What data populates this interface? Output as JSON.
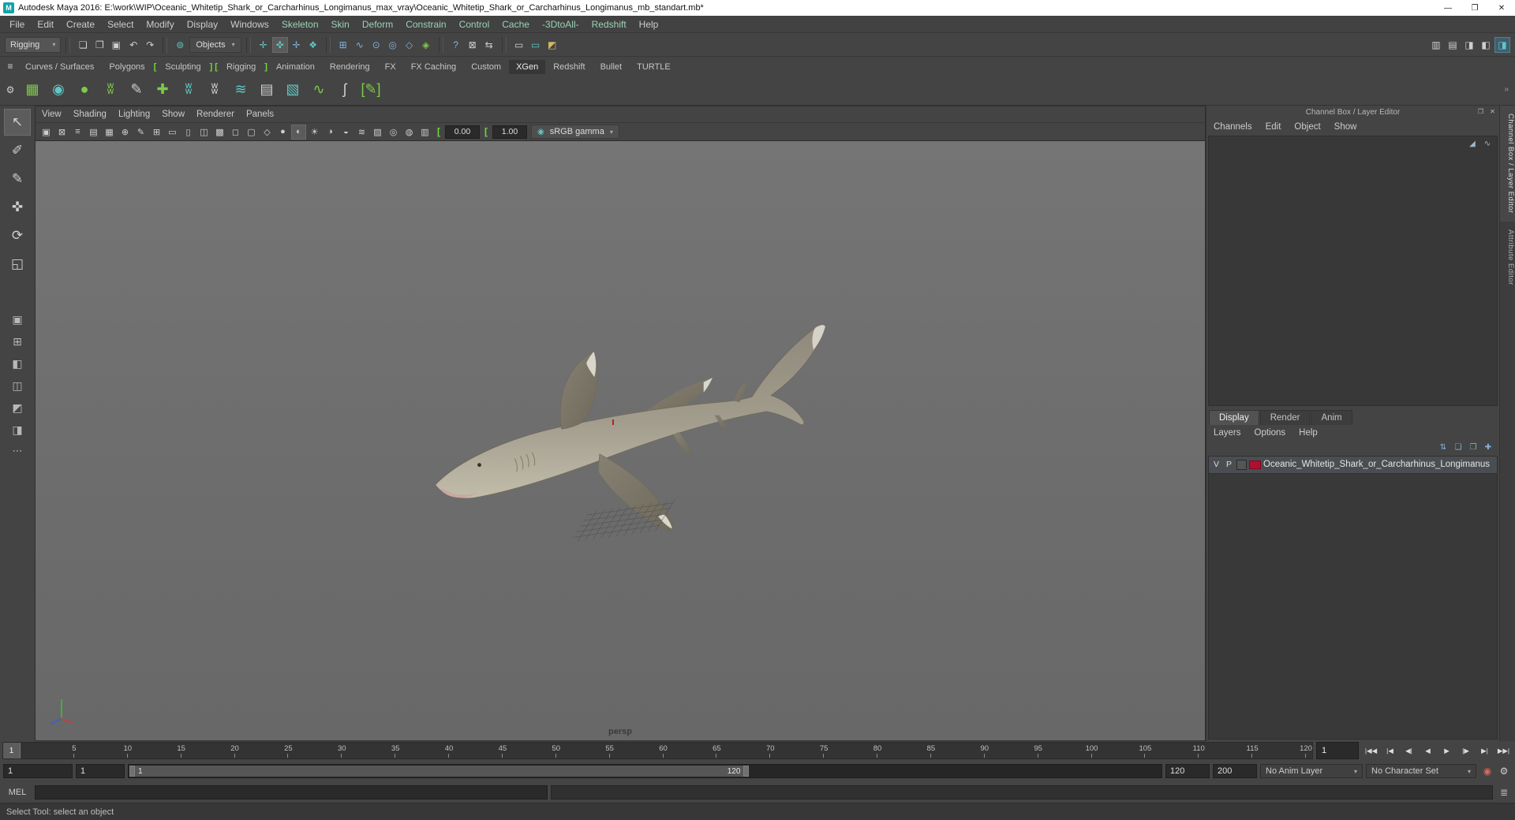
{
  "ui": {
    "arrow": "▾",
    "more": "⋯"
  },
  "colors": {
    "ui_bg": "#444444",
    "panel_dark": "#2b2b2b",
    "viewport_bg": "#6e6e6e",
    "accent_teal": "#5fc7c4",
    "accent_green": "#7ecb45",
    "shelf_bracket_green": "#74d63e",
    "layer_swatch_red": "#b01030"
  },
  "titlebar": {
    "app_icon": "M",
    "title": "Autodesk Maya 2016: E:\\work\\WIP\\Oceanic_Whitetip_Shark_or_Carcharhinus_Longimanus_max_vray\\Oceanic_Whitetip_Shark_or_Carcharhinus_Longimanus_mb_standart.mb*",
    "minimize": "—",
    "maximize": "❐",
    "close": "✕"
  },
  "menubar": {
    "items": [
      {
        "label": "File"
      },
      {
        "label": "Edit"
      },
      {
        "label": "Create"
      },
      {
        "label": "Select"
      },
      {
        "label": "Modify"
      },
      {
        "label": "Display"
      },
      {
        "label": "Windows"
      },
      {
        "label": "Skeleton",
        "cls": "tinted"
      },
      {
        "label": "Skin",
        "cls": "tinted"
      },
      {
        "label": "Deform",
        "cls": "tinted"
      },
      {
        "label": "Constrain",
        "cls": "tinted"
      },
      {
        "label": "Control",
        "cls": "tinted"
      },
      {
        "label": "Cache",
        "cls": "tinted"
      },
      {
        "label": "-3DtoAll-",
        "cls": "tinted"
      },
      {
        "label": "Redshift",
        "cls": "tinted"
      },
      {
        "label": "Help"
      }
    ]
  },
  "statusline": {
    "menuset": "Rigging",
    "file_icons": [
      {
        "name": "new-scene-icon",
        "glyph": "❏",
        "cls": "w"
      },
      {
        "name": "open-scene-icon",
        "glyph": "❐",
        "cls": "w"
      },
      {
        "name": "save-scene-icon",
        "glyph": "▣",
        "cls": "w"
      }
    ],
    "history_icons": [
      {
        "name": "undo-icon",
        "glyph": "↶",
        "cls": "w"
      },
      {
        "name": "redo-icon",
        "glyph": "↷",
        "cls": "w"
      }
    ],
    "selection_mode_icon_glyph": "⊚",
    "selection_mode_label": "Objects",
    "mask_icons": [
      {
        "name": "select-by-hierarchy-icon",
        "glyph": "✛",
        "cls": "t"
      },
      {
        "name": "select-by-object-icon",
        "glyph": "✜",
        "cls": "t pressed"
      },
      {
        "name": "select-by-component-icon",
        "glyph": "✛",
        "cls": "b"
      },
      {
        "name": "highlight-selection-mode-icon",
        "glyph": "❖",
        "cls": "t"
      }
    ],
    "snap_icons": [
      {
        "name": "snap-to-grids-icon",
        "glyph": "⊞",
        "cls": "b"
      },
      {
        "name": "snap-to-curves-icon",
        "glyph": "∿",
        "cls": "b"
      },
      {
        "name": "snap-to-points-icon",
        "glyph": "⊙",
        "cls": "b"
      },
      {
        "name": "snap-to-projected-center-icon",
        "glyph": "◎",
        "cls": "b"
      },
      {
        "name": "snap-to-view-planes-icon",
        "glyph": "◇",
        "cls": "b"
      },
      {
        "name": "make-live-icon",
        "glyph": "◈",
        "cls": "g"
      }
    ],
    "misc_icons": [
      {
        "name": "symmetry-icon",
        "glyph": "?",
        "cls": "b"
      },
      {
        "name": "lock-selection-icon",
        "glyph": "⊠",
        "cls": "w"
      },
      {
        "name": "highlight-affected-icon",
        "glyph": "⇆",
        "cls": "w"
      }
    ],
    "render_icons": [
      {
        "name": "render-current-frame-icon",
        "glyph": "▭",
        "cls": "w"
      },
      {
        "name": "ipr-render-icon",
        "glyph": "▭",
        "cls": "t"
      },
      {
        "name": "render-settings-icon",
        "glyph": "◩",
        "cls": "y"
      }
    ],
    "right_icons": [
      {
        "name": "modeling-toolkit-toggle-icon",
        "glyph": "▥",
        "cls": "w"
      },
      {
        "name": "humanik-toggle-icon",
        "glyph": "▤",
        "cls": "w"
      },
      {
        "name": "attribute-editor-toggle-icon",
        "glyph": "◨",
        "cls": "w"
      },
      {
        "name": "tool-settings-toggle-icon",
        "glyph": "◧",
        "cls": "w"
      },
      {
        "name": "channel-box-toggle-icon",
        "glyph": "◨",
        "cls": "t active"
      }
    ]
  },
  "shelf": {
    "tab_menu_glyph": "≡",
    "gear_glyph": "⚙",
    "overflow_glyph": "»",
    "tabs": [
      {
        "label": "Curves / Surfaces"
      },
      {
        "label": "Polygons"
      },
      {
        "label": "[",
        "cls": "bracket"
      },
      {
        "label": "Sculpting"
      },
      {
        "label": "]",
        "cls": "bracket"
      },
      {
        "label": "[",
        "cls": "bracket"
      },
      {
        "label": "Rigging"
      },
      {
        "label": "]",
        "cls": "bracket"
      },
      {
        "label": "Animation"
      },
      {
        "label": "Rendering"
      },
      {
        "label": "FX"
      },
      {
        "label": "FX Caching"
      },
      {
        "label": "Custom"
      },
      {
        "label": "XGen",
        "active": true
      },
      {
        "label": "Redshift"
      },
      {
        "label": "Bullet"
      },
      {
        "label": "TURTLE"
      }
    ],
    "icons": [
      {
        "name": "xgen-editor-icon",
        "glyph": "▦",
        "cls": "g"
      },
      {
        "name": "xgen-create-description-icon",
        "glyph": "◉",
        "cls": "t"
      },
      {
        "name": "xgen-create-collection-icon",
        "glyph": "●",
        "cls": "g"
      },
      {
        "name": "xgen-add-guides-icon",
        "glyph": "ʬ",
        "cls": "g"
      },
      {
        "name": "xgen-sculpt-guides-icon",
        "glyph": "✎",
        "cls": "w"
      },
      {
        "name": "xgen-place-guides-icon",
        "glyph": "✚",
        "cls": "g"
      },
      {
        "name": "xgen-comb-guides-icon",
        "glyph": "ʬ",
        "cls": "t"
      },
      {
        "name": "xgen-guide-visibility-icon",
        "glyph": "ʬ",
        "cls": "w"
      },
      {
        "name": "xgen-density-brush-icon",
        "glyph": "≋",
        "cls": "t"
      },
      {
        "name": "xgen-attribute-map-icon",
        "glyph": "▤",
        "cls": "w"
      },
      {
        "name": "xgen-region-map-icon",
        "glyph": "▧",
        "cls": "t"
      },
      {
        "name": "xgen-clump-modifier-icon",
        "glyph": "∿",
        "cls": "g"
      },
      {
        "name": "xgen-curves-to-guides-icon",
        "glyph": "ʃ",
        "cls": "w"
      },
      {
        "name": "xgen-export-patches-icon",
        "glyph": "[✎]",
        "cls": "g"
      }
    ]
  },
  "toolbox": {
    "tools": [
      {
        "name": "select-tool",
        "glyph": "↖",
        "cls": "active"
      },
      {
        "name": "lasso-tool",
        "glyph": "✐",
        "cls": "w"
      },
      {
        "name": "paint-select-tool",
        "glyph": "✎",
        "cls": "w"
      },
      {
        "name": "move-tool",
        "glyph": "✜",
        "cls": "t"
      },
      {
        "name": "rotate-tool",
        "glyph": "⟳",
        "cls": "b"
      },
      {
        "name": "scale-tool",
        "glyph": "◱",
        "cls": "y"
      }
    ],
    "layouts": [
      {
        "name": "single-pane-layout-button",
        "glyph": "▣"
      },
      {
        "name": "four-pane-layout-button",
        "glyph": "⊞"
      },
      {
        "name": "persp-outliner-layout-button",
        "glyph": "◧"
      },
      {
        "name": "persp-graph-layout-button",
        "glyph": "◫"
      },
      {
        "name": "hypershade-persp-layout-button",
        "glyph": "◩"
      },
      {
        "name": "persp-uv-layout-button",
        "glyph": "◨"
      }
    ]
  },
  "viewport": {
    "menus": [
      "View",
      "Shading",
      "Lighting",
      "Show",
      "Renderer",
      "Panels"
    ],
    "toolbar_icons": [
      {
        "name": "select-camera-icon",
        "glyph": "▣",
        "cls": "w"
      },
      {
        "name": "lock-camera-icon",
        "glyph": "⊠",
        "cls": "w"
      },
      {
        "name": "camera-attributes-icon",
        "glyph": "≡",
        "cls": "w"
      },
      {
        "name": "bookmarks-icon",
        "glyph": "▤",
        "cls": "w"
      },
      {
        "name": "image-plane-icon",
        "glyph": "▦",
        "cls": "w"
      },
      {
        "name": "2d-pan-zoom-icon",
        "glyph": "⊕",
        "cls": "w"
      },
      {
        "name": "grease-pencil-icon",
        "glyph": "✎",
        "cls": "w"
      },
      {
        "name": "grid-icon",
        "glyph": "⊞",
        "cls": "t"
      },
      {
        "name": "film-gate-icon",
        "glyph": "▭",
        "cls": "w"
      },
      {
        "name": "resolution-gate-icon",
        "glyph": "▯",
        "cls": "w"
      },
      {
        "name": "gate-mask-icon",
        "glyph": "◫",
        "cls": "w"
      },
      {
        "name": "field-chart-icon",
        "glyph": "▩",
        "cls": "w"
      },
      {
        "name": "safe-action-icon",
        "glyph": "◻",
        "cls": "w"
      },
      {
        "name": "safe-title-icon",
        "glyph": "▢",
        "cls": "w"
      },
      {
        "name": "wireframe-icon",
        "glyph": "◇",
        "cls": "w"
      },
      {
        "name": "shaded-icon",
        "glyph": "●",
        "cls": "w"
      },
      {
        "name": "textured-icon",
        "glyph": "◐",
        "cls": "t active"
      },
      {
        "name": "use-all-lights-icon",
        "glyph": "☀",
        "cls": "y"
      },
      {
        "name": "shadows-icon",
        "glyph": "◑",
        "cls": "w"
      },
      {
        "name": "screen-space-ao-icon",
        "glyph": "◒",
        "cls": "w"
      },
      {
        "name": "motion-blur-icon",
        "glyph": "≋",
        "cls": "w"
      },
      {
        "name": "multisample-aa-icon",
        "glyph": "▨",
        "cls": "w"
      },
      {
        "name": "depth-of-field-icon",
        "glyph": "◎",
        "cls": "w"
      },
      {
        "name": "isolate-select-icon",
        "glyph": "◍",
        "cls": "w"
      },
      {
        "name": "xray-icon",
        "glyph": "▥",
        "cls": "w"
      }
    ],
    "exposure_icon": "[",
    "exposure": "0.00",
    "gamma_icon": "[",
    "gamma": "1.00",
    "vt_icon": "◉",
    "view_transform": "sRGB gamma",
    "camera_label": "persp"
  },
  "channel_box": {
    "side_tabs": [
      {
        "label": "Channel Box / Layer Editor",
        "active": true
      },
      {
        "label": "Attribute Editor"
      }
    ],
    "header": "Channel Box / Layer Editor",
    "header_icons": [
      {
        "name": "pop-out-panel-icon",
        "glyph": "❐"
      },
      {
        "name": "close-panel-icon",
        "glyph": "✕"
      }
    ],
    "menus": [
      "Channels",
      "Edit",
      "Object",
      "Show"
    ],
    "corner_icons": [
      {
        "name": "manip-speed-icon",
        "glyph": "◢"
      },
      {
        "name": "hyperbolic-manip-icon",
        "glyph": "∿"
      }
    ],
    "layer_editor": {
      "tabs": [
        {
          "label": "Display",
          "active": true
        },
        {
          "label": "Render"
        },
        {
          "label": "Anim"
        }
      ],
      "menus": [
        "Layers",
        "Options",
        "Help"
      ],
      "icons": [
        {
          "name": "layer-sync-icon",
          "glyph": "⇅"
        },
        {
          "name": "new-empty-layer-icon",
          "glyph": "❏"
        },
        {
          "name": "new-layer-from-selected-icon",
          "glyph": "❐"
        },
        {
          "name": "layer-options-icon",
          "glyph": "✚"
        }
      ],
      "layer": {
        "v": "V",
        "p": "P",
        "name": "Oceanic_Whitetip_Shark_or_Carcharhinus_Longimanus"
      }
    }
  },
  "timeline": {
    "playhead": "1",
    "ticks": [
      "5",
      "10",
      "15",
      "20",
      "25",
      "30",
      "35",
      "40",
      "45",
      "50",
      "55",
      "60",
      "65",
      "70",
      "75",
      "80",
      "85",
      "90",
      "95",
      "100",
      "105",
      "110",
      "115",
      "120"
    ],
    "current_time": "1",
    "transport": [
      {
        "name": "go-to-start-button",
        "glyph": "|◀◀"
      },
      {
        "name": "step-back-frame-button",
        "glyph": "|◀"
      },
      {
        "name": "step-back-key-button",
        "glyph": "◀|"
      },
      {
        "name": "play-backwards-button",
        "glyph": "◀"
      },
      {
        "name": "play-forwards-button",
        "glyph": "▶"
      },
      {
        "name": "step-forward-key-button",
        "glyph": "|▶"
      },
      {
        "name": "step-forward-frame-button",
        "glyph": "▶|"
      },
      {
        "name": "go-to-end-button",
        "glyph": "▶▶|"
      }
    ]
  },
  "range_slider": {
    "anim_start": "1",
    "playback_start": "1",
    "range_start": "1",
    "range_end": "120",
    "playback_end": "120",
    "anim_end": "200",
    "anim_layer": "No Anim Layer",
    "character_set": "No Character Set",
    "icons": [
      {
        "name": "auto-keyframe-icon",
        "glyph": "◉",
        "cls": "r"
      },
      {
        "name": "animation-preferences-icon",
        "glyph": "⚙",
        "cls": "w"
      }
    ]
  },
  "command_line": {
    "label": "MEL",
    "input": "",
    "result": "",
    "script_editor_glyph": "≣"
  },
  "help_line": {
    "text": "Select Tool: select an object"
  }
}
